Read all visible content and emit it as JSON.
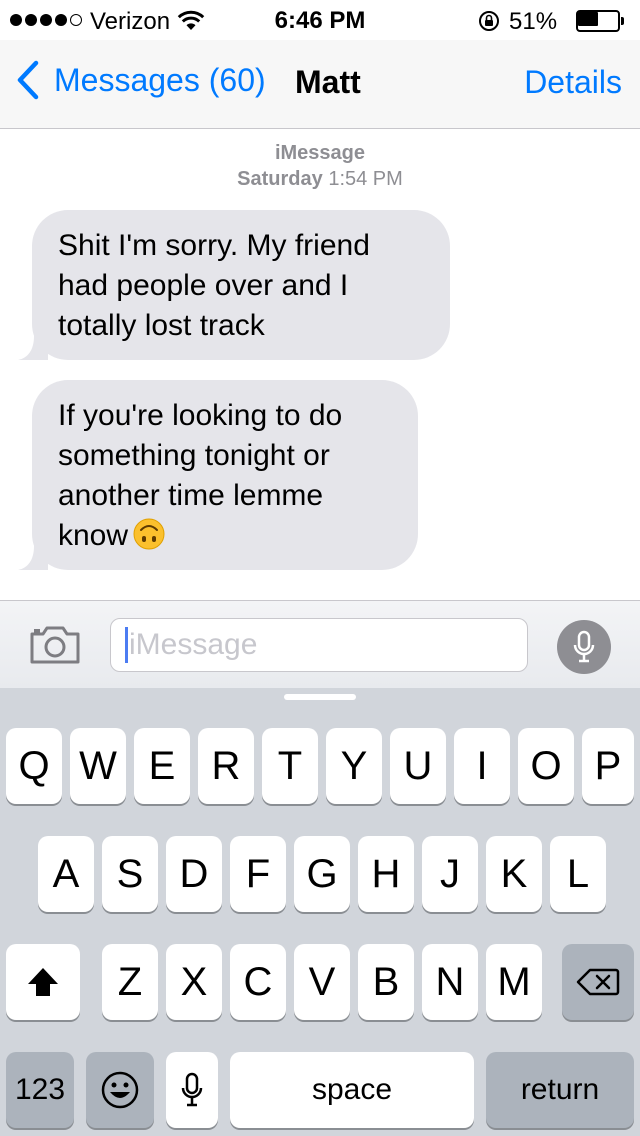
{
  "status_bar": {
    "carrier": "Verizon",
    "signal_bars_filled": 4,
    "signal_bars_total": 5,
    "time": "6:46 PM",
    "battery_percent": "51%",
    "battery_level": 0.51
  },
  "nav": {
    "back_label": "Messages (60)",
    "title": "Matt",
    "details_label": "Details"
  },
  "conversation": {
    "service": "iMessage",
    "day": "Saturday",
    "time": "1:54 PM",
    "messages": [
      {
        "lines": [
          "Shit I'm sorry. My friend",
          "had people over and I",
          "totally lost track"
        ]
      },
      {
        "lines": [
          "If you're looking to do",
          "something tonight or",
          "another time lemme",
          "know"
        ],
        "emoji": "upside-down-face-icon"
      }
    ]
  },
  "input": {
    "placeholder": "iMessage"
  },
  "keyboard": {
    "row1": [
      "Q",
      "W",
      "E",
      "R",
      "T",
      "Y",
      "U",
      "I",
      "O",
      "P"
    ],
    "row2": [
      "A",
      "S",
      "D",
      "F",
      "G",
      "H",
      "J",
      "K",
      "L"
    ],
    "row3": [
      "Z",
      "X",
      "C",
      "V",
      "B",
      "N",
      "M"
    ],
    "numbers_label": "123",
    "space_label": "space",
    "return_label": "return"
  },
  "colors": {
    "accent": "#007aff",
    "incoming_bubble": "#e5e5ea",
    "keyboard_bg": "#d1d5db"
  }
}
